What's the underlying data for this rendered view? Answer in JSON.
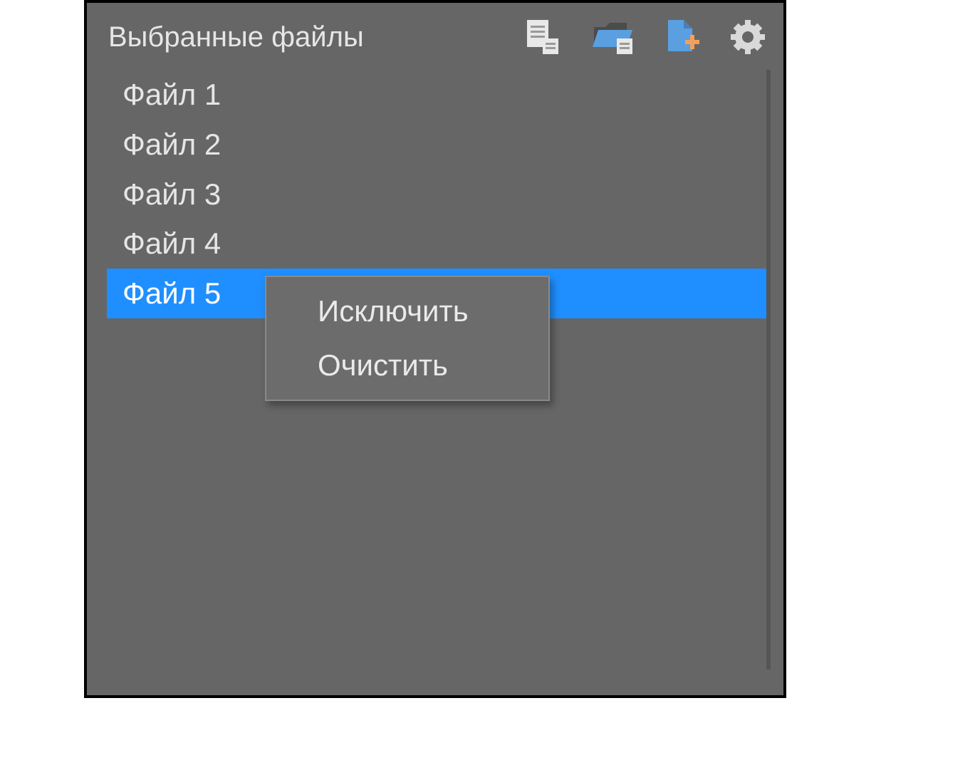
{
  "panel": {
    "title": "Выбранные файлы"
  },
  "toolbar": {
    "file_list_icon": "file-list-icon",
    "open_folder_icon": "open-folder-icon",
    "add_file_icon": "add-file-icon",
    "settings_icon": "gear-icon"
  },
  "files": [
    {
      "label": "Файл 1",
      "selected": false
    },
    {
      "label": "Файл 2",
      "selected": false
    },
    {
      "label": "Файл 3",
      "selected": false
    },
    {
      "label": "Файл 4",
      "selected": false
    },
    {
      "label": "Файл 5",
      "selected": true
    }
  ],
  "context_menu": {
    "items": [
      {
        "label": "Исключить"
      },
      {
        "label": "Очистить"
      }
    ]
  },
  "colors": {
    "panel_bg": "#666666",
    "selection": "#1f8fff",
    "accent_orange": "#f5a05a",
    "accent_blue": "#5a9fe0"
  }
}
